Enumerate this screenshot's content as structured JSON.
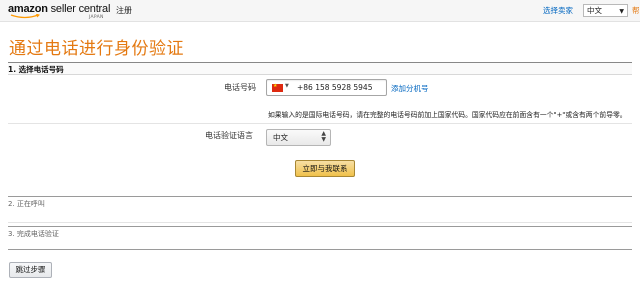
{
  "header": {
    "logo_bold": "amazon",
    "logo_text": "seller central",
    "logo_sub": "JAPAN",
    "register_label": "注册",
    "select_seller_label": "选择卖家",
    "language_value": "中文",
    "help_label": "帮"
  },
  "page": {
    "title": "通过电话进行身份验证"
  },
  "step1": {
    "title": "1. 选择电话号码",
    "phone_label": "电话号码",
    "phone_value": "+86 158 5928 5945",
    "add_phone_label": "添加分机号",
    "hint": "如果输入的是国际电话号码，请在完整的电话号码前加上国家代码。国家代码应在前面含有一个\"+\"或含有两个前导零。",
    "language_label": "电话验证语言",
    "language_value": "中文",
    "call_button_label": "立即与我联系"
  },
  "step2": {
    "title": "2. 正在呼叫"
  },
  "step3": {
    "title": "3. 完成电话验证"
  },
  "footer": {
    "skip_button_label": "跳过步骤"
  },
  "colors": {
    "title_orange": "#e47911",
    "link_blue": "#0066c0",
    "button_yellow": "#f0c14b"
  }
}
